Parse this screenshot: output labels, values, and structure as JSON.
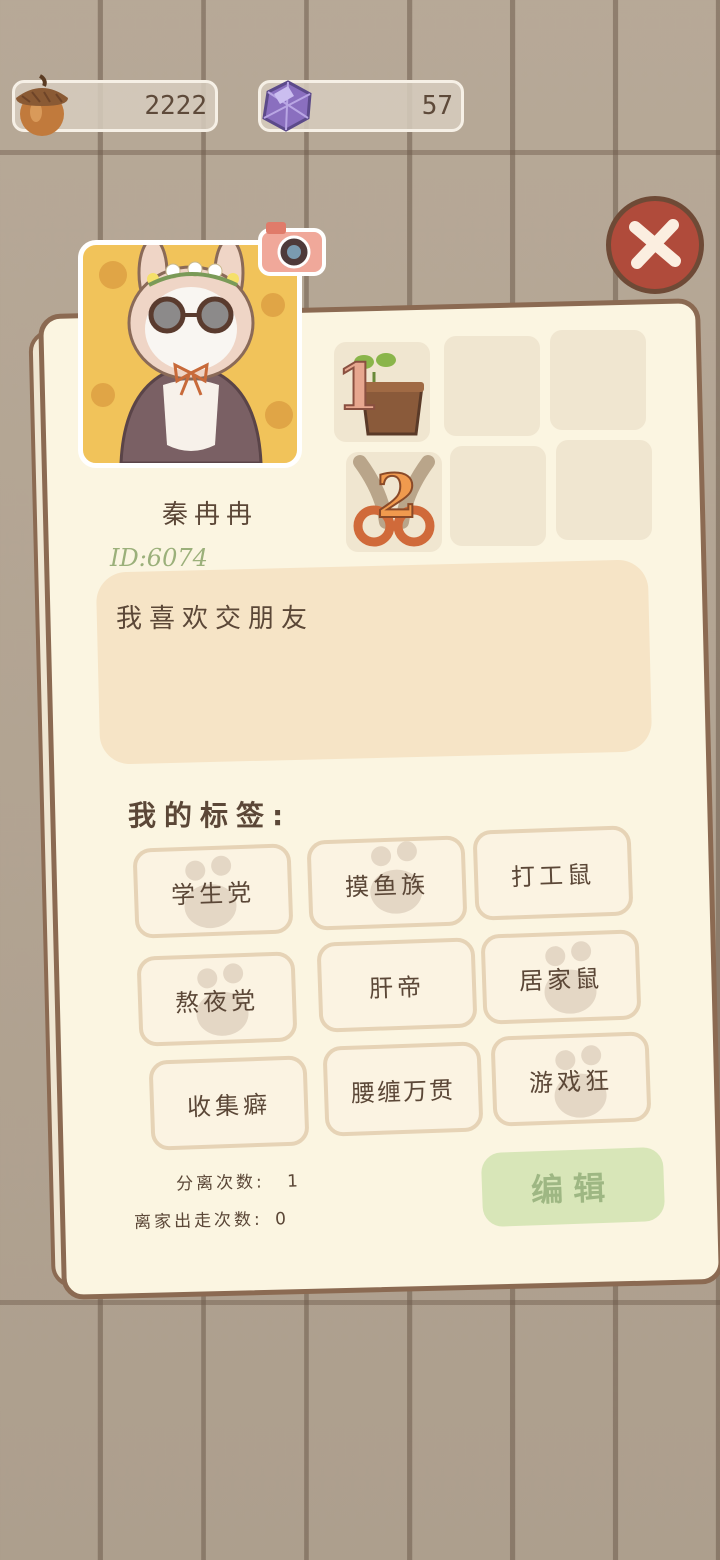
{
  "currency": {
    "acorns": "2222",
    "gems": "57",
    "acorn_icon": "acorn-icon",
    "gem_icon": "purple-gem-icon"
  },
  "profile": {
    "name": "秦冉冉",
    "id": "ID:6074",
    "bio": "我喜欢交朋友"
  },
  "badges": [
    {
      "number": "1",
      "icon": "sprout-pot-icon"
    },
    {
      "number": "2",
      "icon": "boomerang-icon"
    }
  ],
  "tags_title": "我的标签:",
  "tags": [
    "学生党",
    "摸鱼族",
    "打工鼠",
    "熬夜党",
    "肝帝",
    "居家鼠",
    "收集癖",
    "腰缠万贯",
    "游戏狂"
  ],
  "stats": {
    "separations_label": "分离次数:",
    "separations_value": "1",
    "runaway_label": "离家出走次数:",
    "runaway_value": "0"
  },
  "edit_button": "编辑",
  "colors": {
    "card_bg": "#fbf5e1",
    "card_border": "#8b6a52",
    "text": "#5b4737",
    "id_green": "#9bb07a",
    "edit_bg": "#d8e6b8",
    "close_red": "#b04b3b",
    "wood": "#b4a593"
  }
}
